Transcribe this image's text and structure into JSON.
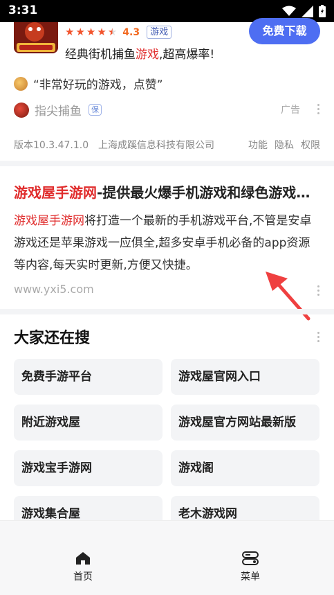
{
  "status_bar": {
    "time": "3:31"
  },
  "ad": {
    "rating_value": "4.3",
    "category_tag": "游戏",
    "download_label": "免费下载",
    "description_pre": "经典街机捕鱼",
    "description_hl": "游戏",
    "description_post": ",超高爆率!",
    "quote": "“非常好玩的游戏，点赞”",
    "source_name": "指尖捕鱼",
    "source_badge": "保",
    "ad_label": "广告",
    "version": "版本10.3.47.1.0",
    "company": "上海成蹊信息科技有限公司",
    "links": [
      "功能",
      "隐私",
      "权限"
    ],
    "stars": 4.5,
    "colors": {
      "button": "#4e6ef2",
      "star": "#f2542d",
      "highlight": "#e02c2c"
    }
  },
  "result": {
    "title_hl": "游戏屋手游网",
    "title_rest": "-提供最火爆手机游戏和绿色游戏下载",
    "body_hl": "游戏屋手游网",
    "body_rest": "将打造一个最新的手机游戏平台,不管是安卓游戏还是苹果游戏一应俱全,超多安卓手机必备的app资源等内容,每天实时更新,方便又快捷。",
    "url": "www.yxi5.com"
  },
  "related": {
    "title": "大家还在搜",
    "items": [
      "免费手游平台",
      "游戏屋官网入口",
      "附近游戏屋",
      "游戏屋官方网站最新版",
      "游戏宝手游网",
      "游戏阁",
      "游戏集合屋",
      "老木游戏网"
    ]
  },
  "bottom_nav": {
    "home_label": "首页",
    "menu_label": "菜单",
    "home_icon": "home-icon",
    "menu_icon": "menu-icon"
  }
}
